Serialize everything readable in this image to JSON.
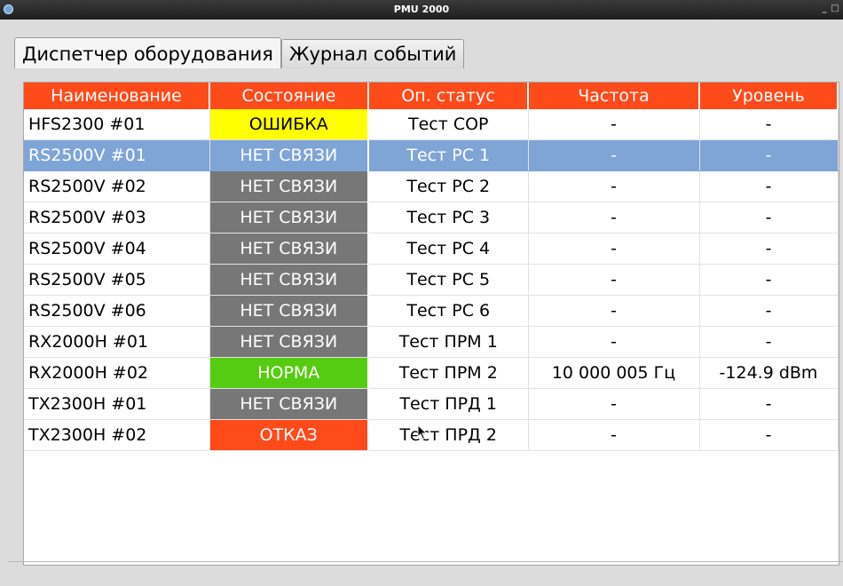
{
  "window": {
    "title": "PMU 2000",
    "controls": [
      "_",
      "□"
    ]
  },
  "tabs": [
    {
      "label": "Диспетчер оборудования",
      "active": true
    },
    {
      "label": "Журнал событий",
      "active": false
    }
  ],
  "table": {
    "headers": [
      "Наименование",
      "Состояние",
      "Оп. статус",
      "Частота",
      "Уровень"
    ],
    "rows": [
      {
        "name": "HFS2300 #01",
        "state": "ОШИБКА",
        "state_kind": "s-err",
        "op": "Тест СОР",
        "freq": "-",
        "level": "-"
      },
      {
        "name": "RS2500V #01",
        "state": "НЕТ СВЯЗИ",
        "state_kind": "s-none",
        "op": "Тест РС 1",
        "freq": "-",
        "level": "-",
        "selected": true
      },
      {
        "name": "RS2500V #02",
        "state": "НЕТ СВЯЗИ",
        "state_kind": "s-none",
        "op": "Тест РС 2",
        "freq": "-",
        "level": "-"
      },
      {
        "name": "RS2500V #03",
        "state": "НЕТ СВЯЗИ",
        "state_kind": "s-none",
        "op": "Тест РС 3",
        "freq": "-",
        "level": "-"
      },
      {
        "name": "RS2500V #04",
        "state": "НЕТ СВЯЗИ",
        "state_kind": "s-none",
        "op": "Тест РС 4",
        "freq": "-",
        "level": "-"
      },
      {
        "name": "RS2500V #05",
        "state": "НЕТ СВЯЗИ",
        "state_kind": "s-none",
        "op": "Тест РС 5",
        "freq": "-",
        "level": "-"
      },
      {
        "name": "RS2500V #06",
        "state": "НЕТ СВЯЗИ",
        "state_kind": "s-none",
        "op": "Тест РС 6",
        "freq": "-",
        "level": "-"
      },
      {
        "name": "RX2000H #01",
        "state": "НЕТ СВЯЗИ",
        "state_kind": "s-none",
        "op": "Тест ПРМ 1",
        "freq": "-",
        "level": "-"
      },
      {
        "name": "RX2000H #02",
        "state": "НОРМА",
        "state_kind": "s-ok",
        "op": "Тест ПРМ 2",
        "freq": "10 000 005 Гц",
        "level": "-124.9 dBm"
      },
      {
        "name": "TX2300H #01",
        "state": "НЕТ СВЯЗИ",
        "state_kind": "s-none",
        "op": "Тест ПРД 1",
        "freq": "-",
        "level": "-"
      },
      {
        "name": "TX2300H #02",
        "state": "ОТКАЗ",
        "state_kind": "s-fail",
        "op": "Тест ПРД 2",
        "freq": "-",
        "level": "-"
      }
    ]
  },
  "colors": {
    "header_bg": "#ff4a1a",
    "error": "#ffff00",
    "no_link": "#777777",
    "ok": "#55cc11",
    "fail": "#ff4a1a",
    "selection": "#7fa4d6"
  }
}
